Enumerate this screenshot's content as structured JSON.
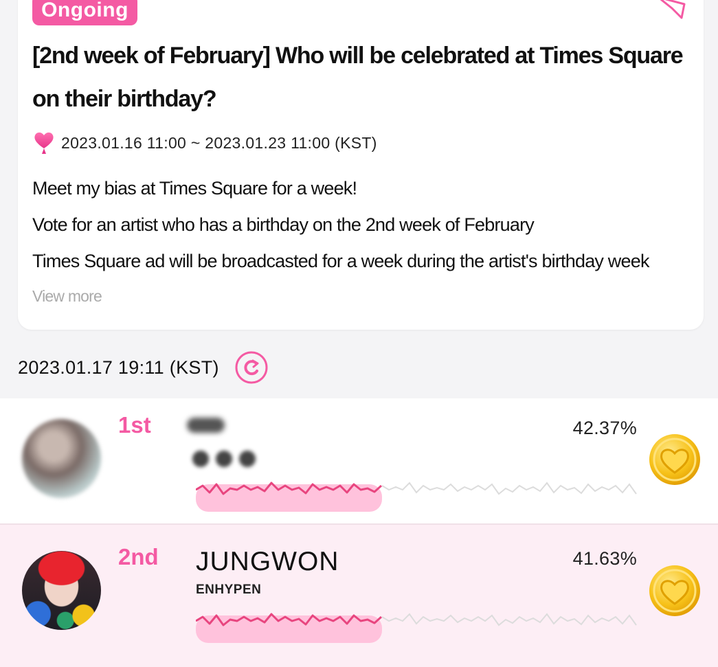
{
  "event": {
    "status_badge": "Ongoing",
    "title": "[2nd week of February] Who will be celebrated at Times Square on their birthday?",
    "period": "2023.01.16 11:00 ~ 2023.01.23 11:00 (KST)",
    "description": [
      "Meet my bias at Times Square for a week!",
      "Vote for an artist who has a birthday on the 2nd week of February",
      "Times Square ad will be broadcasted for a week during the artist's birthday week"
    ],
    "view_more_label": "View more"
  },
  "ranking": {
    "updated_at": "2023.01.17 19:11 (KST)",
    "entries": [
      {
        "rank": "1st",
        "artist": "",
        "group": "",
        "percent": "42.37%",
        "progress": 0.42
      },
      {
        "rank": "2nd",
        "artist": "JUNGWON",
        "group": "ENHYPEN",
        "percent": "41.63%",
        "progress": 0.42
      }
    ]
  },
  "colors": {
    "accent": "#f45aa3",
    "wave_active": "#e8457f",
    "wave_inactive": "#dcdcdc",
    "fill": "#ffc2dc",
    "heart_gold": "#f5b800"
  },
  "icons": {
    "share": "paper-plane-icon",
    "period": "heart-icon",
    "refresh": "refresh-icon",
    "vote": "heart-vote-icon"
  }
}
